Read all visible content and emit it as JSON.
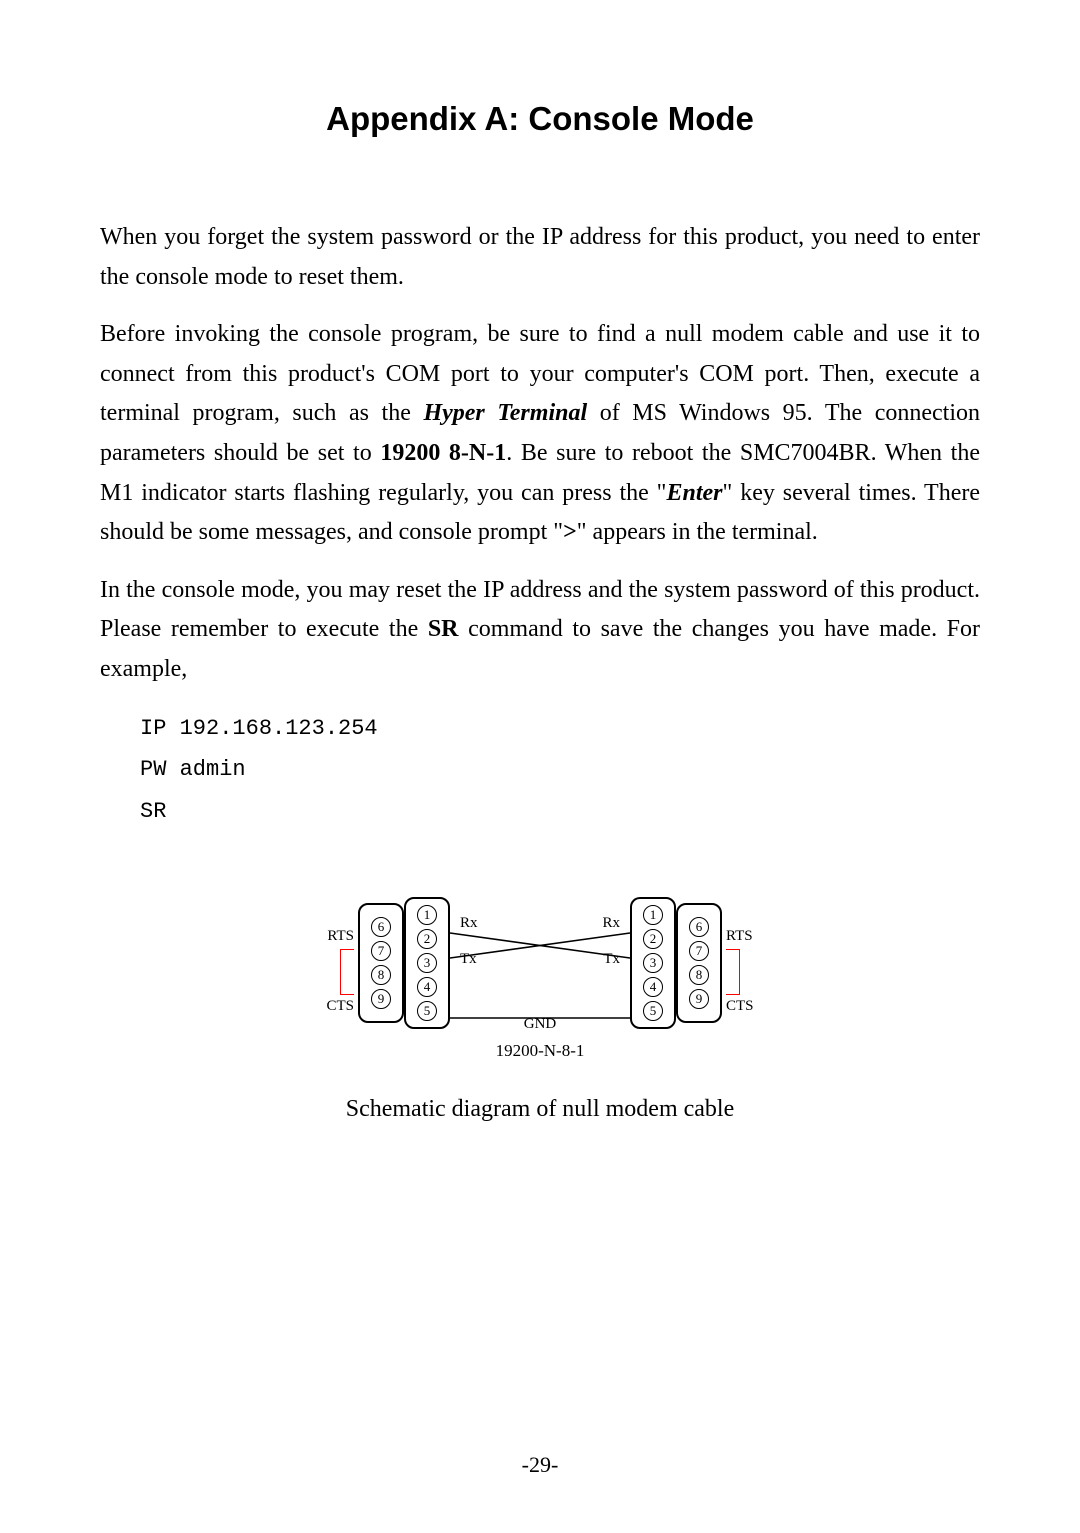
{
  "title": "Appendix A:  Console Mode",
  "para1": "When you forget the system password or the IP address for this product, you need to enter the console mode to reset them.",
  "para2_a": "Before invoking the console program, be sure to find a null modem cable and use it to connect from this product's COM port to your computer's COM port. Then, execute a terminal program, such as the ",
  "hyper_terminal": "Hyper Terminal",
  "para2_b": " of MS Windows 95. The connection parameters should be set to ",
  "baud_setting": "19200 8-N-1",
  "para2_c": ". Be sure to  reboot the SMC7004BR.  When the M1 indicator starts flashing regularly, you can press the \"",
  "enter_key": "Enter",
  "para2_d": "\" key several times.  There should be some messages, and console prompt \"",
  "prompt": ">",
  "para2_e": "\" appears in the terminal.",
  "para3_a": "In the console mode, you may reset the IP address and the system password of this product. Please remember to execute the ",
  "sr_cmd": "SR",
  "para3_b": " command to save the changes you have made. For example,",
  "code_line1": "IP 192.168.123.254",
  "code_line2": "PW admin",
  "code_line3": "SR",
  "diagram": {
    "pins_left_outer": [
      "6",
      "7",
      "8",
      "9"
    ],
    "pins_left_inner": [
      "1",
      "2",
      "3",
      "4",
      "5"
    ],
    "pins_right_inner": [
      "1",
      "2",
      "3",
      "4",
      "5"
    ],
    "pins_right_outer": [
      "6",
      "7",
      "8",
      "9"
    ],
    "rx": "Rx",
    "tx": "Tx",
    "gnd": "GND",
    "rts": "RTS",
    "cts": "CTS",
    "setting_label": "19200-N-8-1"
  },
  "caption": "Schematic diagram of null modem cable",
  "page_number": "-29-"
}
